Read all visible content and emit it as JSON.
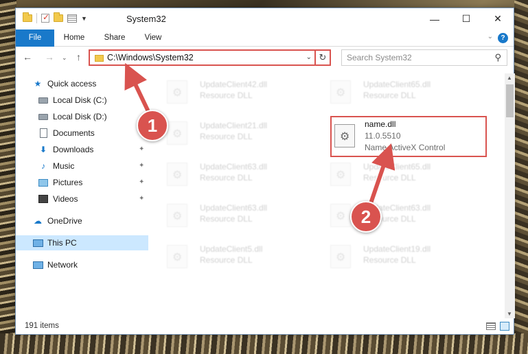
{
  "window": {
    "title": "System32",
    "controls": {
      "minimize": "—",
      "maximize": "☐",
      "close": "✕"
    }
  },
  "ribbon": {
    "tabs": [
      "File",
      "Home",
      "Share",
      "View"
    ],
    "expand_glyph": "⌄",
    "help_glyph": "?"
  },
  "nav": {
    "back_glyph": "←",
    "forward_glyph": "→",
    "recent_glyph": "⌄",
    "up_glyph": "↑",
    "address_path": "C:\\Windows\\System32",
    "address_dropdown_glyph": "⌄",
    "refresh_glyph": "↻",
    "search_placeholder": "Search System32",
    "search_glyph": "⚲"
  },
  "sidebar": {
    "items": [
      {
        "label": "Quick access",
        "icon": "star-icon",
        "pinned": false
      },
      {
        "label": "Local Disk (C:)",
        "icon": "drive-icon",
        "pinned": false
      },
      {
        "label": "Local Disk (D:)",
        "icon": "drive-icon",
        "pinned": false
      },
      {
        "label": "Documents",
        "icon": "documents-icon",
        "pinned": true
      },
      {
        "label": "Downloads",
        "icon": "downloads-icon",
        "pinned": true
      },
      {
        "label": "Music",
        "icon": "music-icon",
        "pinned": true
      },
      {
        "label": "Pictures",
        "icon": "pictures-icon",
        "pinned": true
      },
      {
        "label": "Videos",
        "icon": "videos-icon",
        "pinned": true
      },
      {
        "label": "OneDrive",
        "icon": "onedrive-icon",
        "pinned": false
      },
      {
        "label": "This PC",
        "icon": "this-pc-icon",
        "pinned": false,
        "selected": true
      },
      {
        "label": "Network",
        "icon": "network-icon",
        "pinned": false
      }
    ],
    "pin_glyph": "📌"
  },
  "files": {
    "col1": [
      {
        "name": "UpdateClient42.dll",
        "type": "Resource DLL"
      },
      {
        "name": "UpdateClient21.dll",
        "type": "Resource DLL"
      },
      {
        "name": "UpdateClient63.dll",
        "type": "Resource DLL"
      },
      {
        "name": "UpdateClient63.dll",
        "type": "Resource DLL"
      },
      {
        "name": "UpdateClient5.dll",
        "type": "Resource DLL"
      }
    ],
    "col2": [
      {
        "name": "UpdateClient65.dll",
        "type": "Resource DLL"
      },
      {
        "name": "name.dll",
        "version": "11.0.5510",
        "type": "Name ActiveX Control",
        "highlighted": true
      },
      {
        "name": "UpdateClient65.dll",
        "type": "Resource DLL"
      },
      {
        "name": "UpdateClient63.dll",
        "type": "Resource DLL"
      },
      {
        "name": "UpdateClient19.dll",
        "type": "Resource DLL"
      }
    ]
  },
  "status": {
    "item_count": "191 items"
  },
  "annotations": {
    "badge1": "1",
    "badge2": "2",
    "accent_color": "#d9534f"
  }
}
